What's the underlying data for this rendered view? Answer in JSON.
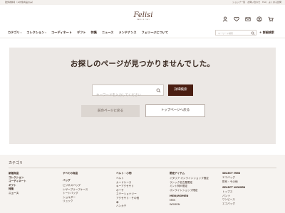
{
  "topbar": {
    "notice": "【送料無料】（※対象商品のみ）",
    "links": [
      "ショップ一覧",
      "お問い合わせ",
      "FAQ",
      "よくある質問"
    ]
  },
  "header": {
    "logo_text": "Felisi",
    "logo_sub": "MADE IN ITALY",
    "icons": [
      "user-icon",
      "heart-icon",
      "mail-icon",
      "account-icon",
      "cart-icon"
    ]
  },
  "nav": {
    "items": [
      {
        "label": "カテゴリ",
        "has_dropdown": true
      },
      {
        "label": "コレクション",
        "has_dropdown": true
      },
      {
        "label": "コーディネート",
        "has_dropdown": false
      },
      {
        "label": "ギフト",
        "has_dropdown": false
      },
      {
        "label": "特集",
        "has_dropdown": false
      },
      {
        "label": "ニュース",
        "has_dropdown": false
      },
      {
        "label": "メンテナンス",
        "has_dropdown": false
      },
      {
        "label": "フェリージについて",
        "has_dropdown": false
      }
    ],
    "search_placeholder": "キーワード検索",
    "advanced_search": "+ 詳細検索"
  },
  "main": {
    "heading": "お探しのページが見つかりませんでした。",
    "keyword_placeholder": "キーワードを入力してください",
    "detail_search_button": "詳細検索",
    "back_button": "前のページに戻る",
    "top_button": "トップページへ戻る"
  },
  "footer": {
    "title": "カテゴリ",
    "col1": [
      "新着商品",
      "コレクション",
      "コーディネート",
      "ギフト",
      "特集",
      "ニュース"
    ],
    "col2": {
      "header": "すべての商品",
      "group": "バッグ",
      "items": [
        "ビジネスバッグ",
        "レザーブリーフケース",
        "トートバッグ",
        "ショルダー",
        "リュック"
      ]
    },
    "col3": {
      "header": "ベルト・小物",
      "items": [
        "ベルト",
        "カードケース",
        "キーアクセサリ",
        "ポーチ",
        "ステーショナリー",
        "アクセサリ・その他",
        "傘",
        "ハンカチ"
      ]
    },
    "col4": {
      "header": "限定アイテム",
      "items": [
        "イタリア オンラインショップ限定",
        "ラシック名古屋限定",
        "ミント神戸限定",
        "オンラインショップ限定"
      ],
      "header2": "MEN/WOMEN",
      "items2": [
        "MEN",
        "WOMEN"
      ]
    },
    "col5": {
      "header": "SELECT MEN",
      "items": [
        "エコバッグ",
        "財布・その他"
      ],
      "header2": "SELECT WOMEN",
      "items2": [
        "トップス",
        "パンツ",
        "ワンピース",
        "エコバッグ"
      ]
    }
  }
}
